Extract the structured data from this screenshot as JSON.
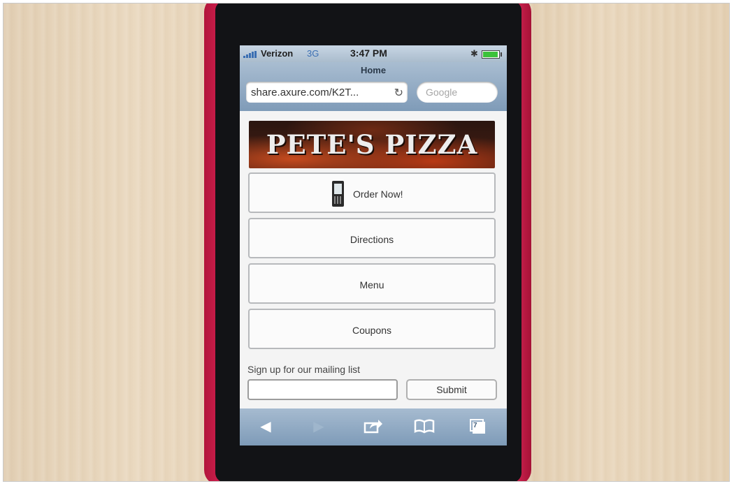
{
  "status_bar": {
    "carrier": "Verizon",
    "network": "3G",
    "time": "3:47 PM",
    "bluetooth_icon": "bluetooth-icon",
    "battery_level": 0.95
  },
  "browser": {
    "page_title": "Home",
    "url": "share.axure.com/K2T...",
    "search_placeholder": "Google",
    "toolbar": {
      "back_icon": "back-arrow-icon",
      "forward_icon": "forward-arrow-icon",
      "share_icon": "share-icon",
      "bookmarks_icon": "book-icon",
      "tabs_count": "7"
    }
  },
  "page": {
    "banner": "PETE'S PIZZA",
    "buttons": [
      {
        "label": "Order Now!",
        "icon": "mobile-phone-icon"
      },
      {
        "label": "Directions"
      },
      {
        "label": "Menu"
      },
      {
        "label": "Coupons"
      }
    ],
    "mailing_label": "Sign up for our mailing list",
    "mailing_input_value": "",
    "submit_label": "Submit"
  },
  "colors": {
    "phone_case": "#d11d4f",
    "safari_bar": "#8fa8c2",
    "background_wood": "#e4d0b3"
  }
}
